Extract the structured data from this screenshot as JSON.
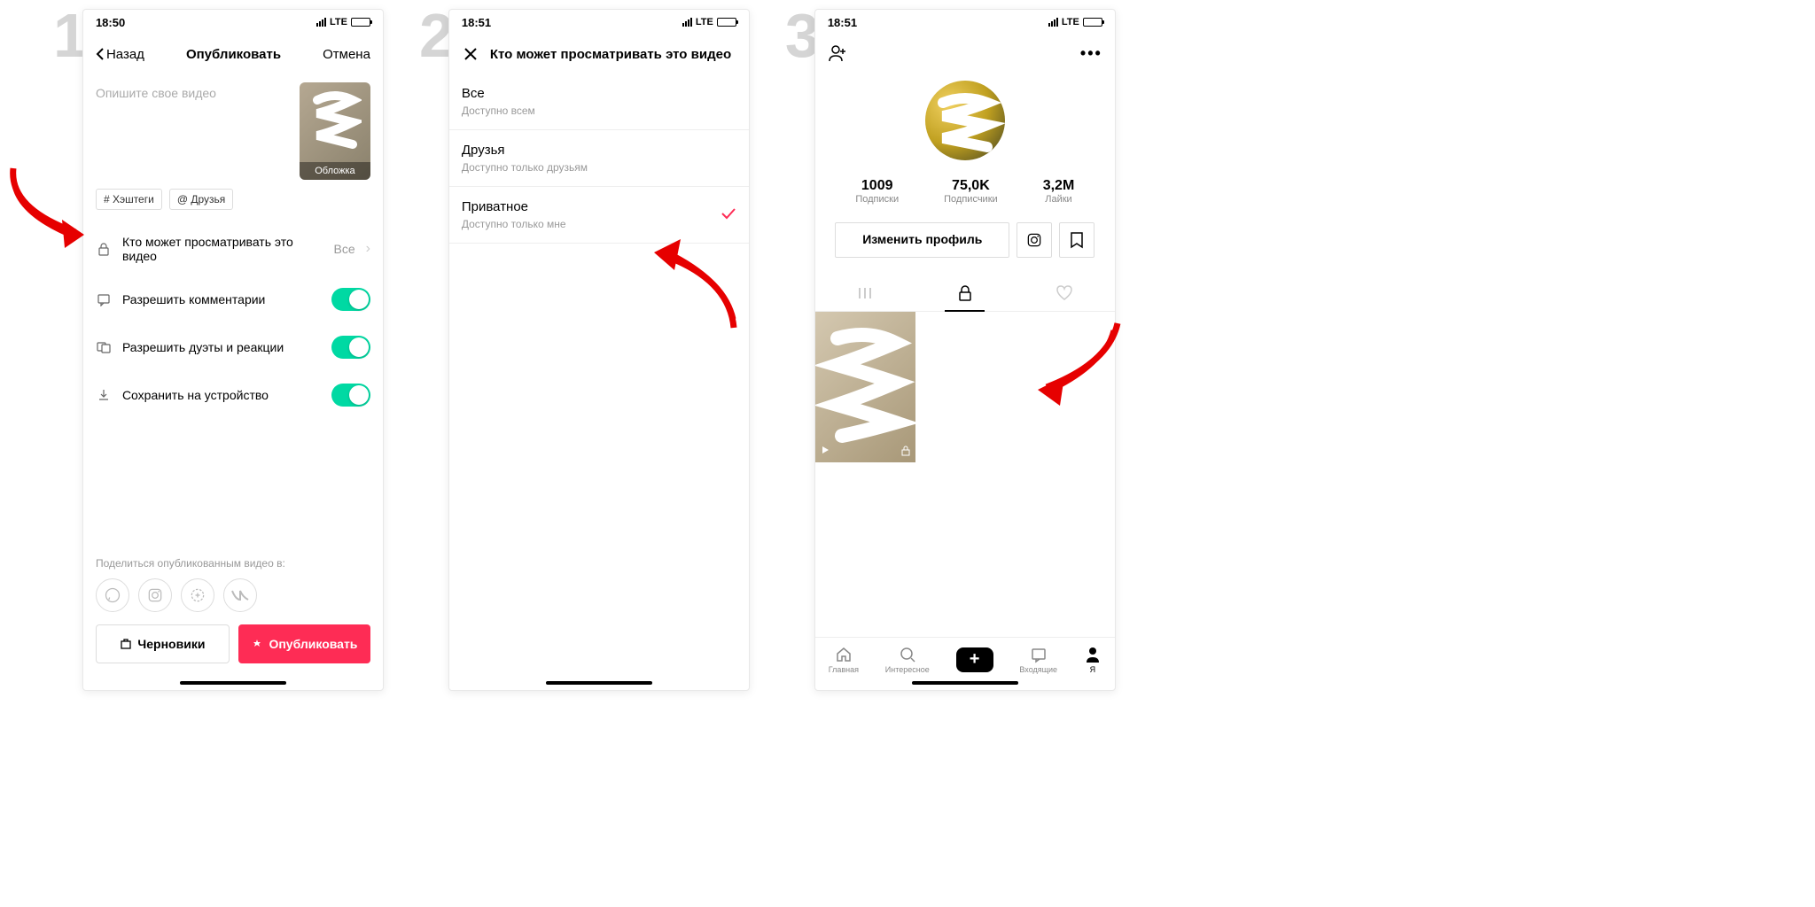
{
  "screen1": {
    "step": "1",
    "time": "18:50",
    "lte": "LTE",
    "nav_back": "Назад",
    "nav_title": "Опубликовать",
    "nav_cancel": "Отмена",
    "desc_placeholder": "Опишите свое видео",
    "thumb_label": "Обложка",
    "tag_hashtag": "# Хэштеги",
    "tag_friends": "@ Друзья",
    "privacy_label": "Кто может просматривать это видео",
    "privacy_value": "Все",
    "comments_label": "Разрешить комментарии",
    "duets_label": "Разрешить дуэты и реакции",
    "save_label": "Сохранить на устройство",
    "share_label": "Поделиться опубликованным видео в:",
    "btn_drafts": "Черновики",
    "btn_publish": "Опубликовать"
  },
  "screen2": {
    "step": "2",
    "time": "18:51",
    "lte": "LTE",
    "title": "Кто может просматривать это видео",
    "options": [
      {
        "title": "Все",
        "sub": "Доступно всем",
        "checked": false
      },
      {
        "title": "Друзья",
        "sub": "Доступно только друзьям",
        "checked": false
      },
      {
        "title": "Приватное",
        "sub": "Доступно только мне",
        "checked": true
      }
    ]
  },
  "screen3": {
    "step": "3",
    "time": "18:51",
    "lte": "LTE",
    "stats": [
      {
        "num": "1009",
        "label": "Подписки"
      },
      {
        "num": "75,0K",
        "label": "Подписчики"
      },
      {
        "num": "3,2M",
        "label": "Лайки"
      }
    ],
    "edit_btn": "Изменить профиль",
    "nav": [
      {
        "label": "Главная"
      },
      {
        "label": "Интересное"
      },
      {
        "label": ""
      },
      {
        "label": "Входящие"
      },
      {
        "label": "Я"
      }
    ]
  }
}
